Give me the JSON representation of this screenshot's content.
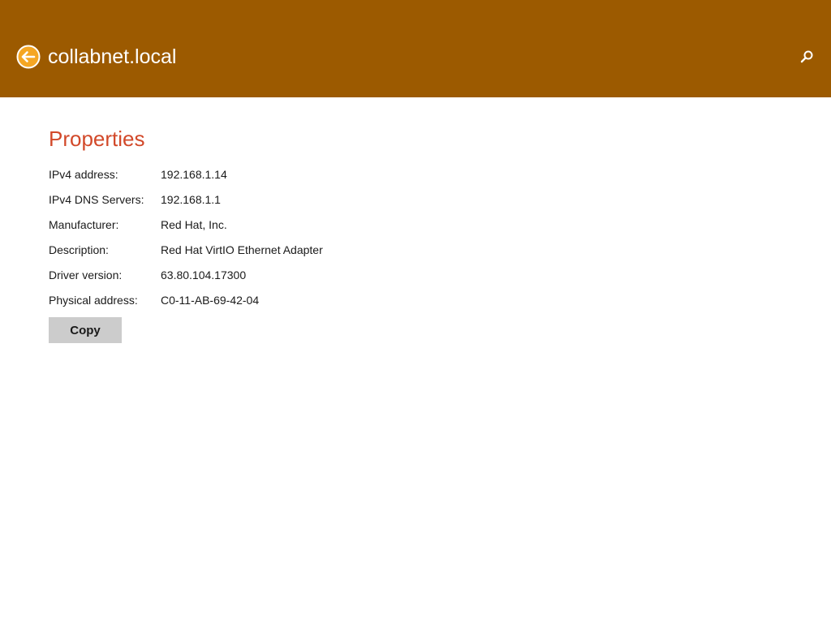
{
  "colors": {
    "header_bg": "#9c5a00",
    "accent_title": "#d2492a",
    "button_bg": "#cccccc"
  },
  "header": {
    "title": "collabnet.local",
    "back_icon": "back-arrow-icon",
    "search_icon": "search-icon"
  },
  "properties": {
    "title": "Properties",
    "rows": [
      {
        "label": "IPv4 address:",
        "value": "192.168.1.14"
      },
      {
        "label": "IPv4 DNS Servers:",
        "value": "192.168.1.1"
      },
      {
        "label": "Manufacturer:",
        "value": "Red Hat, Inc."
      },
      {
        "label": "Description:",
        "value": "Red Hat VirtIO Ethernet Adapter"
      },
      {
        "label": "Driver version:",
        "value": "63.80.104.17300"
      },
      {
        "label": "Physical address:",
        "value": "C0-11-AB-69-42-04"
      }
    ],
    "copy_label": "Copy"
  }
}
